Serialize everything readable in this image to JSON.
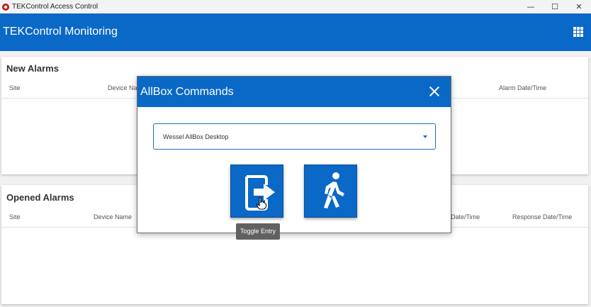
{
  "window": {
    "title": "TEKControl Access Control",
    "controls": {
      "minimize": "—",
      "maximize": "☐",
      "close": "✕"
    }
  },
  "appbar": {
    "title": "TEKControl Monitoring"
  },
  "new_alarms": {
    "title": "New Alarms",
    "columns": [
      "Site",
      "Device Na",
      "Alarm Date/Time"
    ]
  },
  "opened_alarms": {
    "title": "Opened Alarms",
    "columns": [
      "Site",
      "Device Name",
      "Date/Time",
      "Response Date/Time"
    ]
  },
  "dialog": {
    "title": "AllBox Commands",
    "selected_device": "Wessel AllBox Desktop",
    "buttons": [
      {
        "icon": "door-exit-icon",
        "tooltip": "Toggle Entry"
      },
      {
        "icon": "walking-person-icon"
      }
    ],
    "tooltip_text": "Toggle Entry"
  },
  "colors": {
    "primary": "#0a68c7",
    "tooltip": "#616161"
  }
}
